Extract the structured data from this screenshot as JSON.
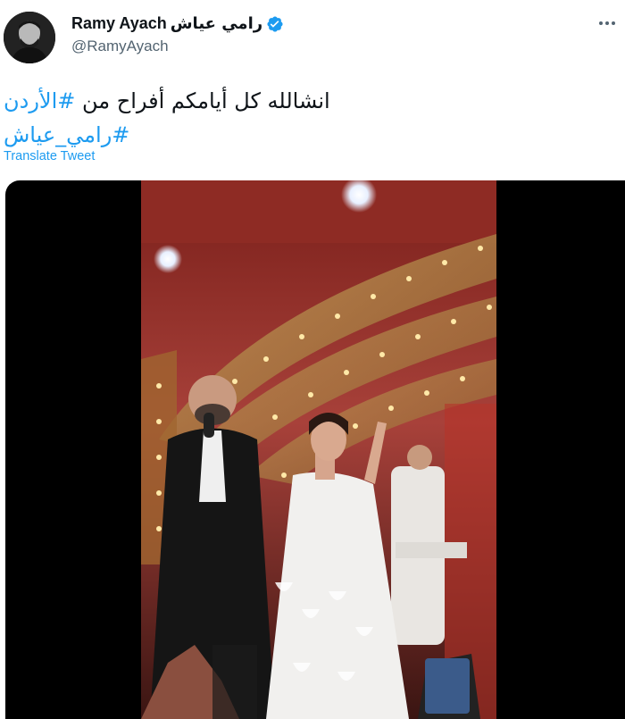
{
  "tweet": {
    "author": {
      "display_name": "Ramy Ayach",
      "display_name_ar": "رامي عياش",
      "handle": "@RamyAyach",
      "verified": true,
      "avatar_icon": "profile-avatar"
    },
    "text_line1_prefix": "انشالله كل أيامكم أفراح من ",
    "hashtag1": "#الأردن",
    "hashtag2": "#رامي_عياش",
    "translate_label": "Translate Tweet"
  },
  "colors": {
    "link": "#1d9bf0",
    "text": "#0f1419",
    "secondary": "#536471"
  },
  "media": {
    "type": "video",
    "icon": "video-frame"
  }
}
